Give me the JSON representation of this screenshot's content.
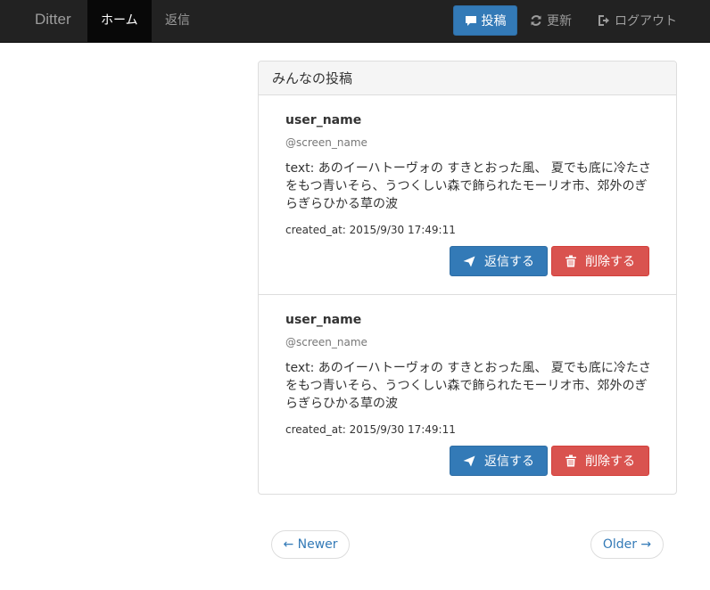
{
  "navbar": {
    "brand": "Ditter",
    "home": "ホーム",
    "reply": "返信",
    "post_button": "投稿",
    "refresh": "更新",
    "logout": "ログアウト"
  },
  "panel": {
    "heading": "みんなの投稿"
  },
  "posts": [
    {
      "user_name": "user_name",
      "screen_name": "@screen_name",
      "text": "text: あのイーハトーヴォの すきとおった風、 夏でも底に冷たさをもつ青いそら、うつくしい森で飾られたモーリオ市、郊外のぎらぎらひかる草の波",
      "created_at": "created_at: 2015/9/30 17:49:11",
      "reply_label": "返信する",
      "delete_label": "削除する"
    },
    {
      "user_name": "user_name",
      "screen_name": "@screen_name",
      "text": "text: あのイーハトーヴォの すきとおった風、 夏でも底に冷たさをもつ青いそら、うつくしい森で飾られたモーリオ市、郊外のぎらぎらひかる草の波",
      "created_at": "created_at: 2015/9/30 17:49:11",
      "reply_label": "返信する",
      "delete_label": "削除する"
    }
  ],
  "pager": {
    "newer": "← Newer",
    "older": "Older →"
  },
  "colors": {
    "navbar_bg": "#222222",
    "primary": "#337ab7",
    "danger": "#d9534f"
  }
}
